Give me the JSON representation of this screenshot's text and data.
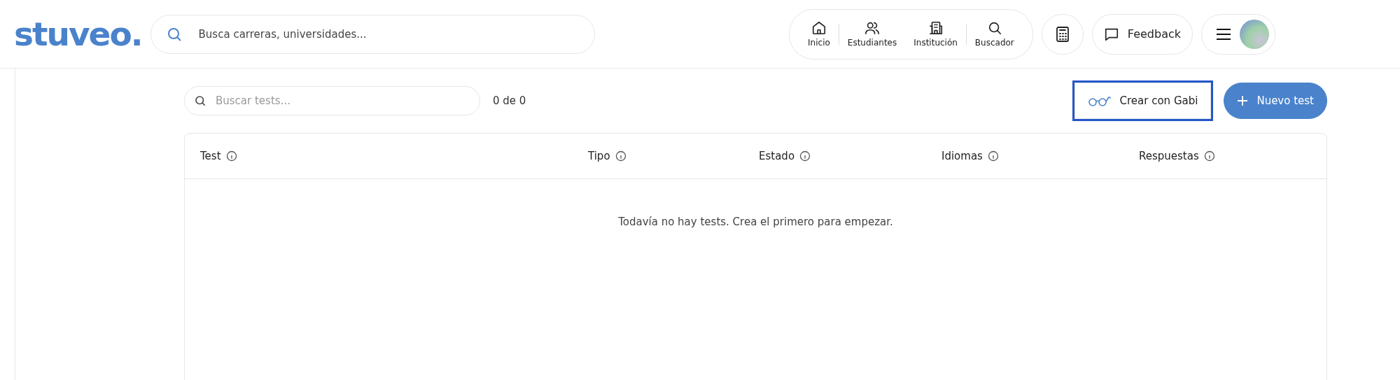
{
  "header": {
    "logo": "stuveo.",
    "search": {
      "placeholder": "Busca carreras, universidades..."
    },
    "nav": [
      {
        "label": "Inicio",
        "kind": "home"
      },
      {
        "label": "Estudiantes",
        "kind": "users"
      },
      {
        "label": "Institución",
        "kind": "building"
      },
      {
        "label": "Buscador",
        "kind": "search"
      }
    ],
    "feedback": "Feedback"
  },
  "toolbar": {
    "search": {
      "placeholder": "Buscar tests..."
    },
    "count": "0 de 0",
    "buttons": [
      {
        "label": "Crear con Gabi",
        "kind": "secondary",
        "highlighted": true
      },
      {
        "label": "Nuevo test",
        "kind": "primary",
        "highlighted": false
      }
    ]
  },
  "table": {
    "columns": [
      "Test",
      "Tipo",
      "Estado",
      "Idiomas",
      "Respuestas"
    ],
    "empty_message": "Todavía no hay tests. Crea el primero para empezar."
  }
}
